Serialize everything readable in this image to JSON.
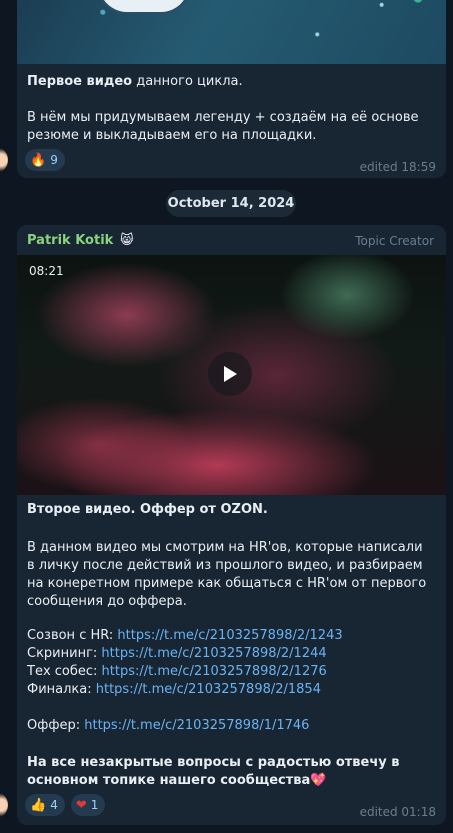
{
  "message1": {
    "headline_bold": "Первое видео",
    "headline_rest": " данного цикла.",
    "body": "В нём мы придумываем легенду + создаём на её основе резюме и выкладываем его на площадки.",
    "reactions": [
      {
        "emoji": "🔥",
        "count": "9"
      }
    ],
    "edited": "edited 18:59"
  },
  "date_separator": "October 14, 2024",
  "message2": {
    "sender": "Patrik Kotik",
    "sender_emoji": "😸",
    "role": "Topic Creator",
    "video_duration": "08:21",
    "title": "Второе видео. Оффер от OZON.",
    "body": "В данном видео мы смотрим на HR'ов, которые написали в личку после действий из прошлого видео, и разбираем на конеретном примере как общаться с HR'ом от первого сообщения до оффера.",
    "links": [
      {
        "label": "Созвон с HR: ",
        "url": "https://t.me/c/2103257898/2/1243"
      },
      {
        "label": "Скрининг: ",
        "url": "https://t.me/c/2103257898/2/1244"
      },
      {
        "label": "Тех собес: ",
        "url": "https://t.me/c/2103257898/2/1276"
      },
      {
        "label": "Финалка: ",
        "url": "https://t.me/c/2103257898/2/1854"
      }
    ],
    "offer_label": "Оффер: ",
    "offer_url": "https://t.me/c/2103257898/1/1746",
    "closing": "На все незакрытые вопросы с радостью отвечу в основном топике нашего сообщества",
    "closing_emoji": "💖",
    "reactions": [
      {
        "emoji": "👍",
        "count": "4"
      },
      {
        "emoji": "❤",
        "count": "1"
      }
    ],
    "edited": "edited 01:18"
  },
  "colors": {
    "background": "#0e1621",
    "bubble": "#182533",
    "sender_name": "#8ad27d",
    "link": "#6ab3f3",
    "meta": "#6b7d8c"
  }
}
